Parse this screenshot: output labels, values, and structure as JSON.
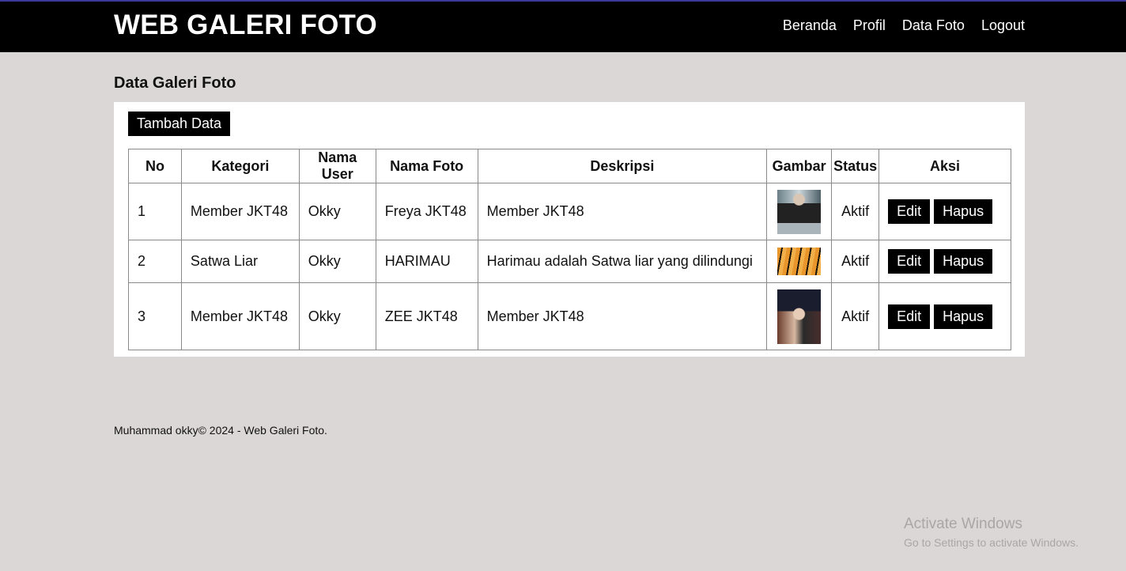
{
  "header": {
    "brand": "WEB GALERI FOTO",
    "nav": [
      "Beranda",
      "Profil",
      "Data Foto",
      "Logout"
    ]
  },
  "page": {
    "title": "Data Galeri Foto",
    "add_button": "Tambah Data"
  },
  "table": {
    "columns": [
      "No",
      "Kategori",
      "Nama User",
      "Nama Foto",
      "Deskripsi",
      "Gambar",
      "Status",
      "Aksi"
    ],
    "rows": [
      {
        "no": "1",
        "kategori": "Member JKT48",
        "user": "Okky",
        "foto": "Freya JKT48",
        "deskripsi": "Member JKT48",
        "status": "Aktif",
        "edit": "Edit",
        "hapus": "Hapus"
      },
      {
        "no": "2",
        "kategori": "Satwa Liar",
        "user": "Okky",
        "foto": "HARIMAU",
        "deskripsi": "Harimau adalah Satwa liar yang dilindungi",
        "status": "Aktif",
        "edit": "Edit",
        "hapus": "Hapus"
      },
      {
        "no": "3",
        "kategori": "Member JKT48",
        "user": "Okky",
        "foto": "ZEE JKT48",
        "deskripsi": "Member JKT48",
        "status": "Aktif",
        "edit": "Edit",
        "hapus": "Hapus"
      }
    ]
  },
  "footer": {
    "text": "Muhammad okky© 2024 - Web Galeri Foto."
  },
  "watermark": {
    "line1": "Activate Windows",
    "line2": "Go to Settings to activate Windows."
  },
  "colors": {
    "header_bg": "#000000",
    "page_bg": "#dcd7d7",
    "button_bg": "#000000"
  }
}
